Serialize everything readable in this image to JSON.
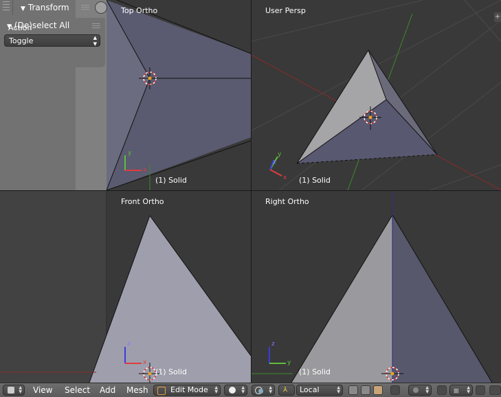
{
  "tool_panel": {
    "transform_header": "Transform",
    "deselect_header": "(De)select All",
    "action_label": "Action",
    "action_value": "Toggle"
  },
  "viewports": {
    "top_left": {
      "label": "Top Ortho",
      "status": "(1) Solid"
    },
    "top_right": {
      "label": "User Persp",
      "status": "(1) Solid"
    },
    "bottom_left": {
      "label": "Front Ortho",
      "status": "(1) Solid"
    },
    "bottom_right": {
      "label": "Right Ortho",
      "status": "(1) Solid"
    }
  },
  "axes": {
    "x": "x",
    "y": "y",
    "z": "z"
  },
  "header": {
    "menus": [
      "View",
      "Select",
      "Add",
      "Mesh"
    ],
    "mode": "Edit Mode",
    "orientation": "Local"
  },
  "colors": {
    "mesh_light": "#9a9aa8",
    "mesh_dark": "#5a5a6e",
    "x_axis": "#e03c3c",
    "y_axis": "#5fbf3a",
    "z_axis": "#3c3cdc"
  },
  "icons": {
    "viewport_type": "cube-view-icon",
    "mode": "edit-mode-icon",
    "shading": "sphere-icon",
    "pivot": "pivot-icon",
    "manipulator": "manipulator-icon",
    "snap": "magnet-icon"
  }
}
